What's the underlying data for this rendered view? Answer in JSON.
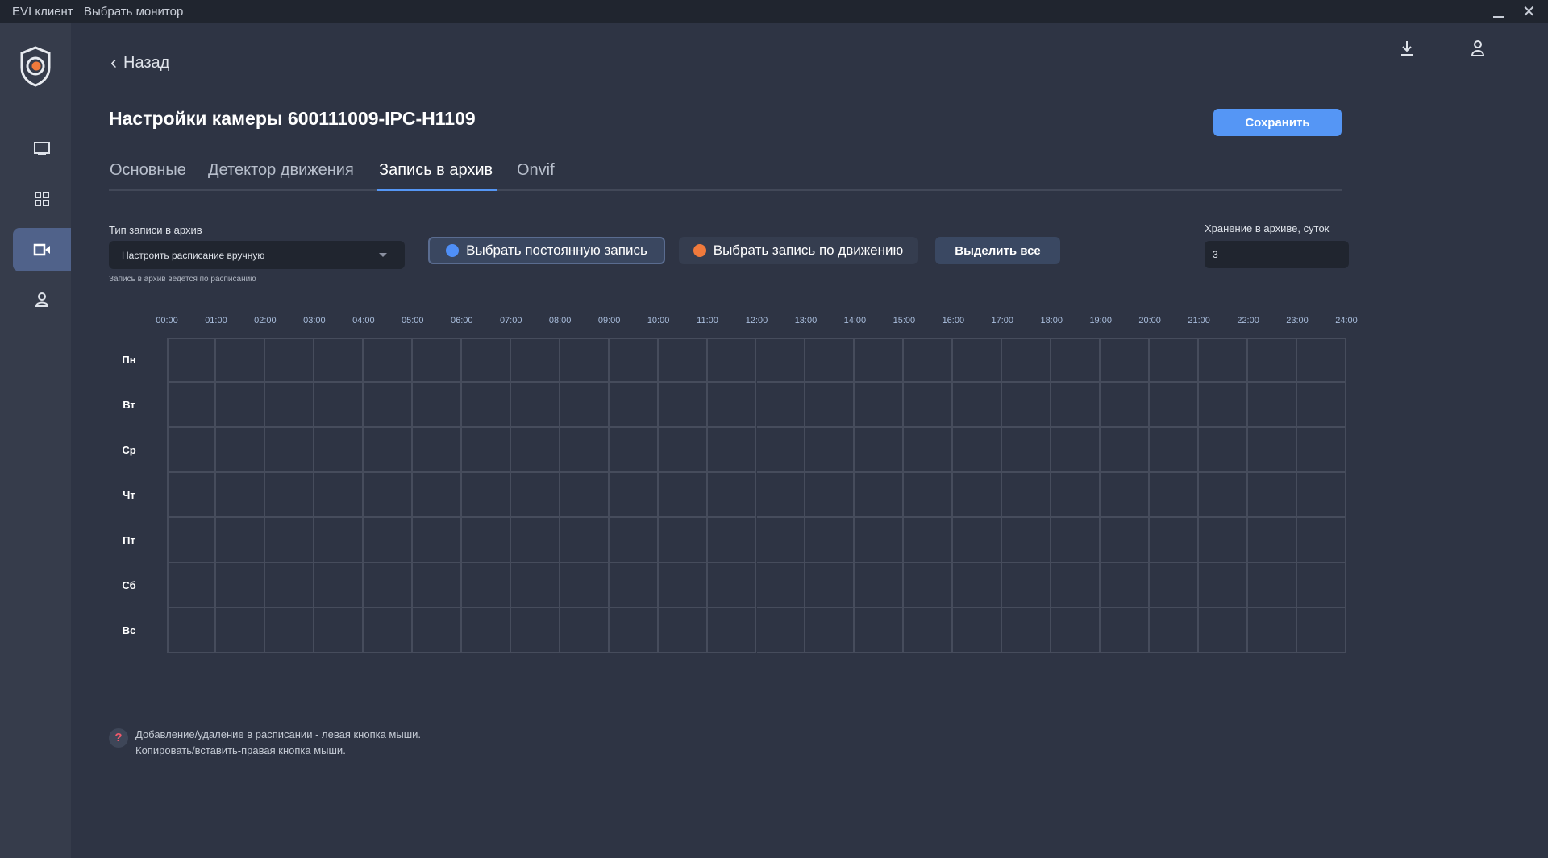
{
  "titlebar": {
    "app": "EVI клиент",
    "menu": "Выбрать монитор"
  },
  "header": {
    "back": "Назад",
    "title": "Настройки камеры 600111009-IPC-H1109",
    "save": "Сохранить"
  },
  "tabs": [
    {
      "label": "Основные"
    },
    {
      "label": "Детектор движения"
    },
    {
      "label": "Запись в архив"
    },
    {
      "label": "Onvif"
    }
  ],
  "record": {
    "type_label": "Тип записи в архив",
    "type_value": "Настроить расписание вручную",
    "type_hint": "Запись в архив ведется по расписанию",
    "constant_btn": "Выбрать постоянную запись",
    "motion_btn": "Выбрать запись по движению",
    "select_all": "Выделить все",
    "storage_label": "Хранение в архиве, суток",
    "storage_value": "3"
  },
  "colors": {
    "constant": "#4f8ff7",
    "motion": "#f07a3c",
    "accent": "#5596f5"
  },
  "schedule": {
    "hours": [
      "00:00",
      "01:00",
      "02:00",
      "03:00",
      "04:00",
      "05:00",
      "06:00",
      "07:00",
      "08:00",
      "09:00",
      "10:00",
      "11:00",
      "12:00",
      "13:00",
      "14:00",
      "15:00",
      "16:00",
      "17:00",
      "18:00",
      "19:00",
      "20:00",
      "21:00",
      "22:00",
      "23:00",
      "24:00"
    ],
    "days": [
      "Пн",
      "Вт",
      "Ср",
      "Чт",
      "Пт",
      "Сб",
      "Вс"
    ]
  },
  "help": {
    "line1": "Добавление/удаление в расписании - левая кнопка мыши.",
    "line2": "Копировать/вставить-правая кнопка мыши."
  }
}
